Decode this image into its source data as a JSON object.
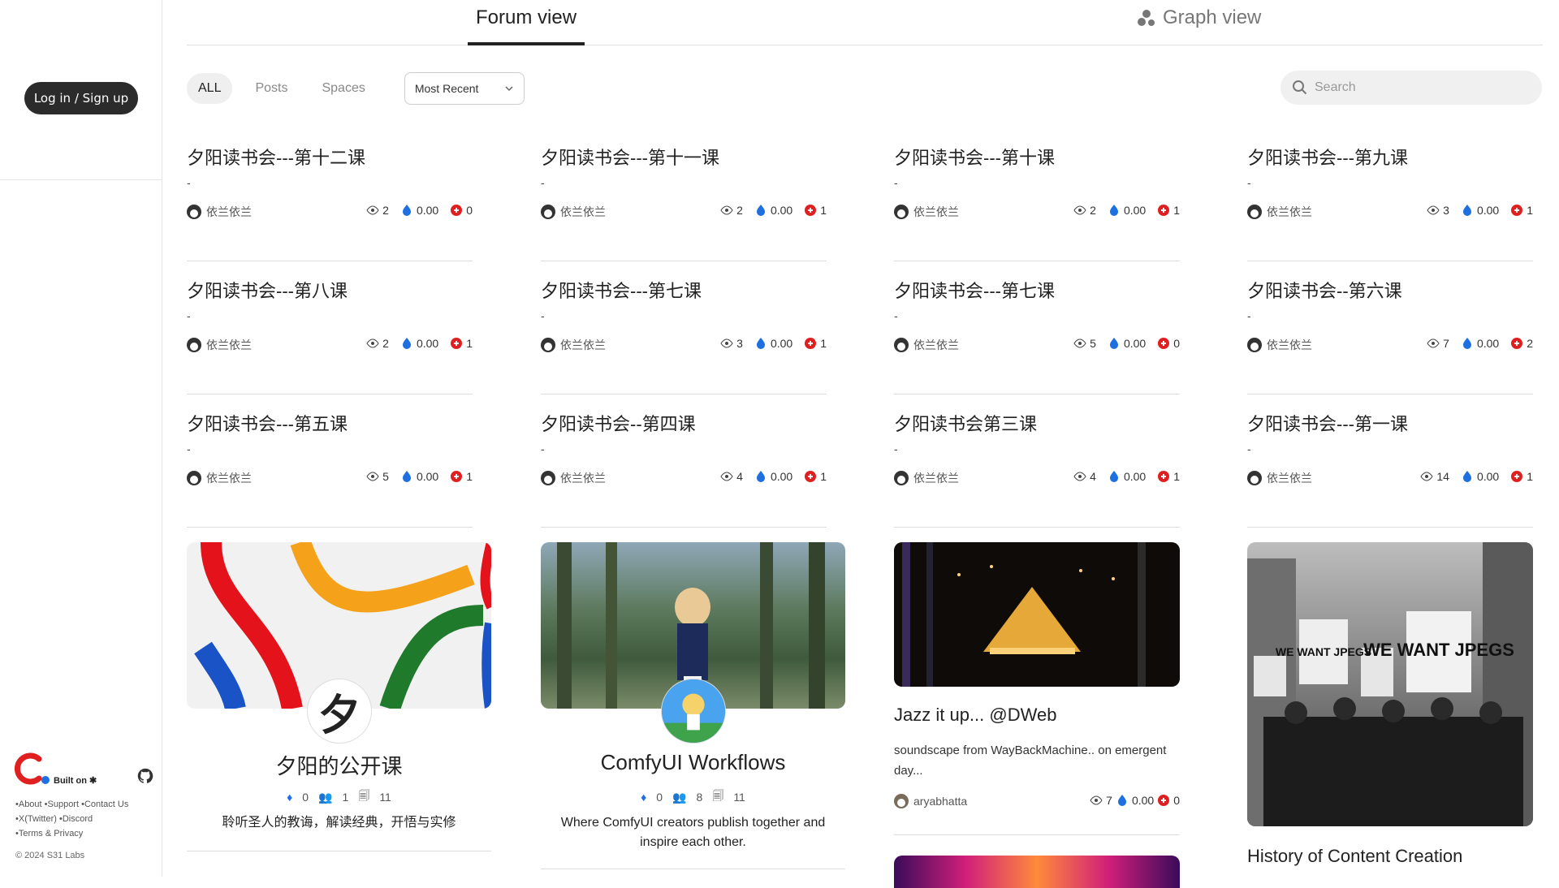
{
  "sidebar": {
    "login_label": "Log in / Sign up",
    "built_on": "Built on",
    "links_row1": "•About •Support •Contact Us",
    "links_row2": "•X(Twitter) •Discord",
    "links_row3": "•Terms & Privacy",
    "copyright": "© 2024 S31 Labs"
  },
  "tabs": {
    "forum": "Forum view",
    "graph": "Graph view"
  },
  "filters": {
    "all": "ALL",
    "posts": "Posts",
    "spaces": "Spaces",
    "sort": "Most Recent"
  },
  "search": {
    "placeholder": "Search"
  },
  "posts": [
    {
      "title": "夕阳读书会---第十二课",
      "excerpt": "-",
      "author": "依兰依兰",
      "views": "2",
      "value": "0.00",
      "comments": "0"
    },
    {
      "title": "夕阳读书会---第十一课",
      "excerpt": "-",
      "author": "依兰依兰",
      "views": "2",
      "value": "0.00",
      "comments": "1"
    },
    {
      "title": "夕阳读书会---第十课",
      "excerpt": "-",
      "author": "依兰依兰",
      "views": "2",
      "value": "0.00",
      "comments": "1"
    },
    {
      "title": "夕阳读书会---第九课",
      "excerpt": "-",
      "author": "依兰依兰",
      "views": "3",
      "value": "0.00",
      "comments": "1"
    },
    {
      "title": "夕阳读书会---第八课",
      "excerpt": "-",
      "author": "依兰依兰",
      "views": "2",
      "value": "0.00",
      "comments": "1"
    },
    {
      "title": "夕阳读书会---第七课",
      "excerpt": "-",
      "author": "依兰依兰",
      "views": "3",
      "value": "0.00",
      "comments": "1"
    },
    {
      "title": "夕阳读书会---第七课",
      "excerpt": "-",
      "author": "依兰依兰",
      "views": "5",
      "value": "0.00",
      "comments": "0"
    },
    {
      "title": "夕阳读书会--第六课",
      "excerpt": "-",
      "author": "依兰依兰",
      "views": "7",
      "value": "0.00",
      "comments": "2"
    },
    {
      "title": "夕阳读书会---第五课",
      "excerpt": "-",
      "author": "依兰依兰",
      "views": "5",
      "value": "0.00",
      "comments": "1"
    },
    {
      "title": "夕阳读书会--第四课",
      "excerpt": "-",
      "author": "依兰依兰",
      "views": "4",
      "value": "0.00",
      "comments": "1"
    },
    {
      "title": "夕阳读书会第三课",
      "excerpt": "-",
      "author": "依兰依兰",
      "views": "4",
      "value": "0.00",
      "comments": "1"
    },
    {
      "title": "夕阳读书会---第一课",
      "excerpt": "-",
      "author": "依兰依兰",
      "views": "14",
      "value": "0.00",
      "comments": "1"
    }
  ],
  "cards": {
    "space1": {
      "logo_char": "夕",
      "name": "夕阳的公开课",
      "value": "0",
      "members": "1",
      "posts": "11",
      "desc": "聆听圣人的教诲，解读经典，开悟与实修"
    },
    "space2": {
      "name": "ComfyUI Workflows",
      "value": "0",
      "members": "8",
      "posts": "11",
      "desc_line1": "Where ComfyUI creators publish together and",
      "desc_line2": "inspire each other."
    },
    "post_jazz": {
      "title": "Jazz it up... @DWeb",
      "excerpt_line1": "soundscape from WayBackMachine.. on emergent",
      "excerpt_line2": "day...",
      "author": "aryabhatta",
      "views": "7",
      "value": "0.00",
      "comments": "0"
    },
    "post_history": {
      "title": "History of Content Creation",
      "sign_big": "WE WANT JPEGS",
      "sign_small": "WE WANT JPEGS"
    }
  },
  "colors": {
    "accent_blue": "#1e6fe0",
    "red": "#e02020",
    "dark": "#2b2b2b"
  }
}
